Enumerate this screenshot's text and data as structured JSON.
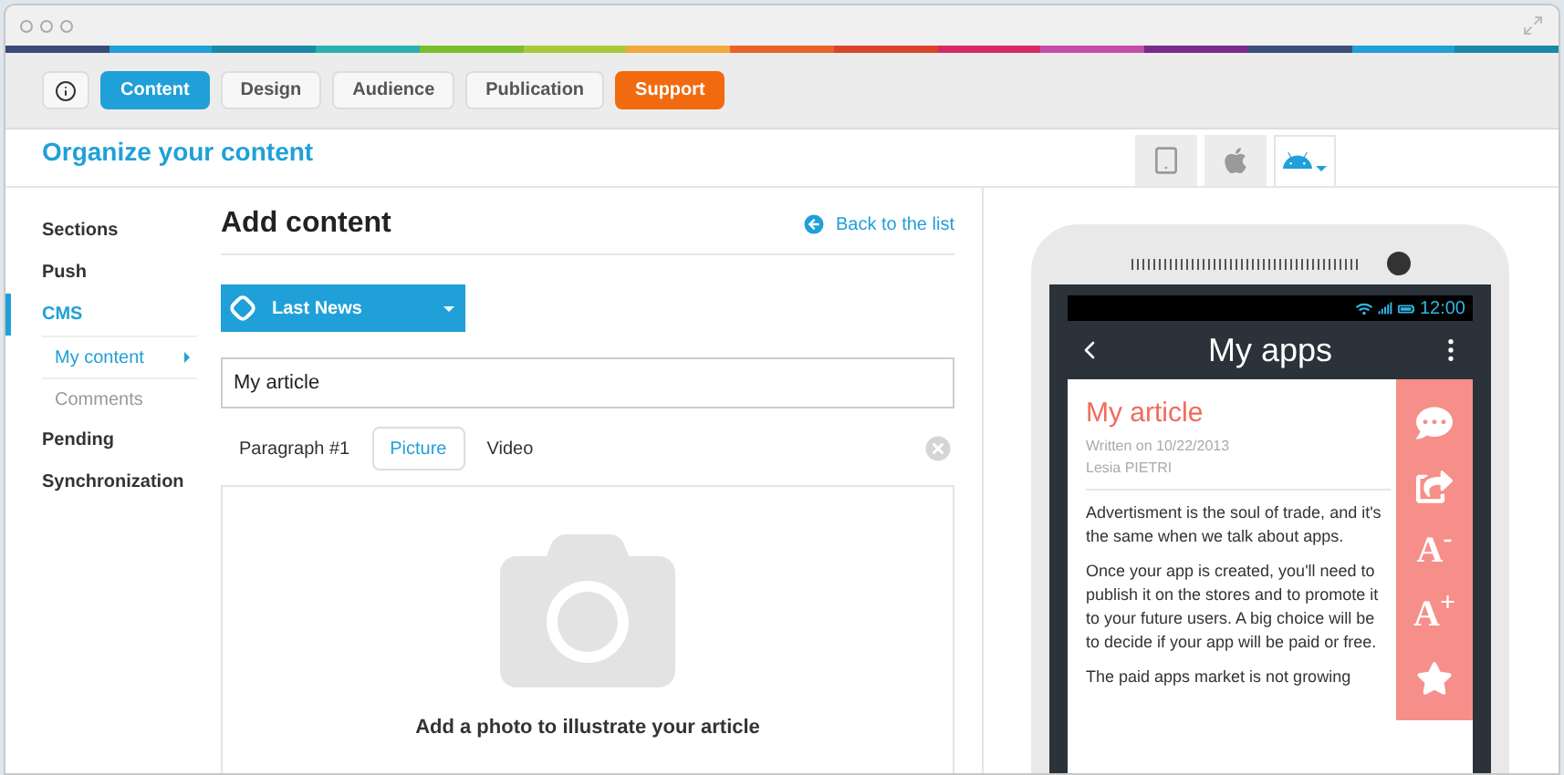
{
  "toolbar": {
    "tabs": [
      {
        "label": "Content",
        "selected": true,
        "kind": "tab"
      },
      {
        "label": "Design",
        "selected": false,
        "kind": "tab"
      },
      {
        "label": "Audience",
        "selected": false,
        "kind": "tab"
      },
      {
        "label": "Publication",
        "selected": false,
        "kind": "tab"
      },
      {
        "label": "Support",
        "kind": "support"
      }
    ]
  },
  "header": {
    "title": "Organize your content",
    "platforms": [
      {
        "kind": "generic",
        "selected": false
      },
      {
        "kind": "apple",
        "selected": false
      },
      {
        "kind": "android",
        "selected": true
      }
    ]
  },
  "sidebar": {
    "items": [
      {
        "label": "Sections",
        "selected": false
      },
      {
        "label": "Push",
        "selected": false
      },
      {
        "label": "CMS",
        "selected": true,
        "children": [
          {
            "label": "My content",
            "selected": true
          },
          {
            "label": "Comments",
            "selected": false
          }
        ]
      },
      {
        "label": "Pending",
        "selected": false
      },
      {
        "label": "Synchronization",
        "selected": false
      }
    ]
  },
  "main": {
    "title": "Add content",
    "back_link": "Back to the list",
    "category": "Last News",
    "title_field": "My article",
    "block_tabs": [
      {
        "label": "Paragraph #1",
        "selected": false
      },
      {
        "label": "Picture",
        "selected": true
      },
      {
        "label": "Video",
        "selected": false
      }
    ],
    "picture_hint": "Add a photo to illustrate your article"
  },
  "phone": {
    "time": "12:00",
    "app_title": "My apps",
    "article_title": "My article",
    "meta": [
      "Written on 10/22/2013",
      "Lesia PIETRI"
    ],
    "paragraphs": [
      "Advertisment is the soul of trade, and it's the same when we talk about apps.",
      "Once your app is created, you'll need to publish it on the stores and to promote it to your future users. A big choice will be to decide if your app will be paid or free.",
      "The paid apps market is not growing"
    ],
    "actions": [
      {
        "kind": "comment"
      },
      {
        "kind": "share"
      },
      {
        "kind": "text",
        "label": "A$^{-}$"
      },
      {
        "kind": "text",
        "label": "A$^{+}$"
      },
      {
        "kind": "star"
      }
    ]
  }
}
